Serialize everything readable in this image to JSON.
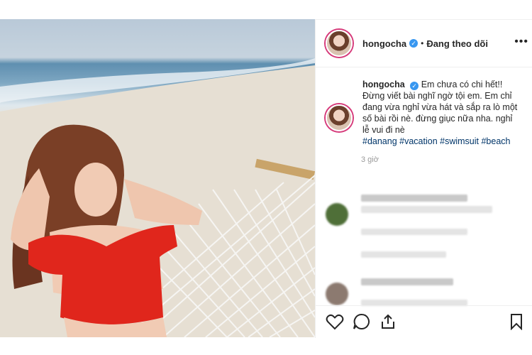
{
  "post": {
    "username": "hongocha",
    "follow_status": "Đang theo dõi",
    "separator": "•",
    "more_label": "•••",
    "caption_user": "hongocha",
    "caption_line1": "Em chưa có chi hết!! Đừng viết bài nghĩ ngờ tội em.",
    "caption_line2": "Em chỉ đang vừa nghỉ vừa hát và sắp ra lò một số bài rồi nè. đừng giục nữa nha. nghỉ lễ vui đi nè",
    "hashtags": "#danang #vacation #swimsuit #beach",
    "time": "3 giờ"
  },
  "icons": {
    "verified": "verified-badge-icon",
    "like": "heart-icon",
    "comment": "comment-icon",
    "share": "share-icon",
    "save": "bookmark-icon"
  },
  "colors": {
    "verified": "#3897f0",
    "story_ring": "#d63a7a",
    "hashtag": "#003569"
  }
}
